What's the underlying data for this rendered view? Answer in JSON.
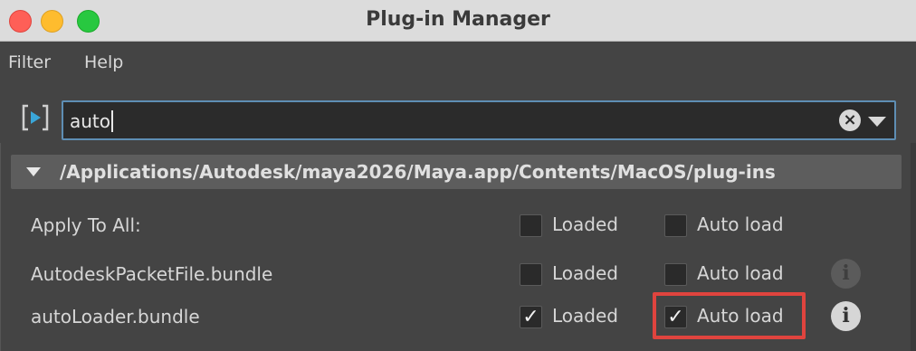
{
  "window": {
    "title": "Plug-in Manager"
  },
  "menu": {
    "items": [
      "Filter",
      "Help"
    ]
  },
  "search": {
    "value": "auto",
    "clear_icon": "clear-icon",
    "dropdown_icon": "chevron-down-icon"
  },
  "section": {
    "path": "/Applications/Autodesk/maya2026/Maya.app/Contents/MacOS/plug-ins",
    "expanded": true
  },
  "apply_all": {
    "label": "Apply To All:",
    "loaded_label": "Loaded",
    "autoload_label": "Auto load",
    "loaded": false,
    "autoload": false
  },
  "plugins": [
    {
      "name": "AutodeskPacketFile.bundle",
      "loaded_label": "Loaded",
      "autoload_label": "Auto load",
      "loaded": false,
      "autoload": false,
      "info_icon": "info-icon",
      "info_enabled": false
    },
    {
      "name": "autoLoader.bundle",
      "loaded_label": "Loaded",
      "autoload_label": "Auto load",
      "loaded": true,
      "autoload": true,
      "info_icon": "info-icon",
      "info_enabled": true,
      "highlighted": "autoload"
    }
  ],
  "colors": {
    "highlight": "#e0443e",
    "search_border": "#5e8eb4",
    "background": "#444444"
  }
}
